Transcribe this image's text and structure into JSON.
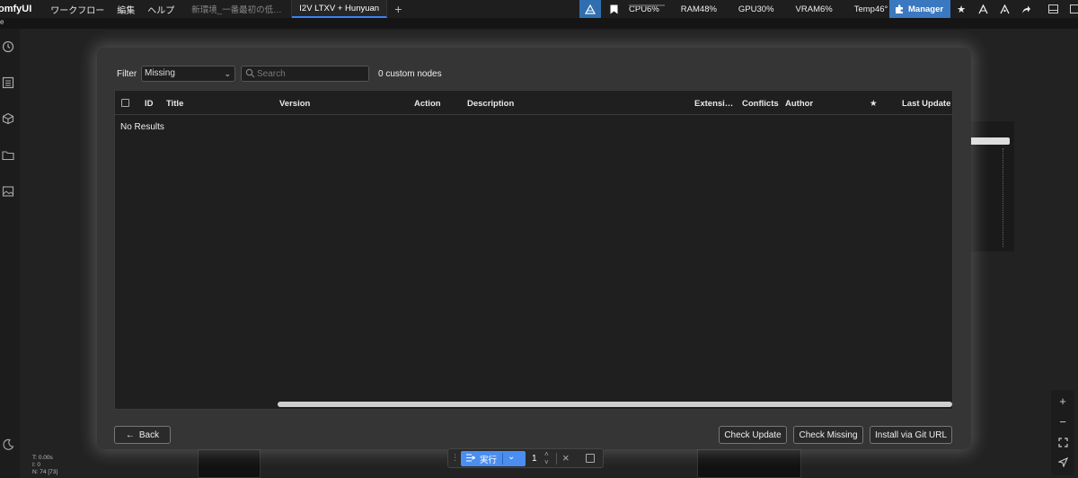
{
  "topbar": {
    "logo": "omfyUI",
    "menu": [
      "ワークフロー",
      "編集",
      "ヘルプ"
    ],
    "tabs": [
      {
        "label": "新環境_一番最初の低…",
        "active": false
      },
      {
        "label": "I2V LTXV + Hunyuan",
        "active": true
      }
    ],
    "add_tab": "+",
    "stats": [
      {
        "label": "CPU6%",
        "value": 6
      },
      {
        "label": "RAM48%",
        "value": 48
      },
      {
        "label": "GPU30%",
        "value": 30
      },
      {
        "label": "VRAM6%",
        "value": 6
      },
      {
        "label": "Temp46°",
        "value": 46
      }
    ],
    "manager_label": "Manager"
  },
  "subbar": {
    "text": "e"
  },
  "modal": {
    "filter_label": "Filter",
    "filter_value": "Missing",
    "search_placeholder": "Search",
    "count_text": "0 custom nodes",
    "columns": [
      "ID",
      "Title",
      "Version",
      "Action",
      "Description",
      "Extensi…",
      "Conflicts",
      "Author",
      "★",
      "Last Update"
    ],
    "empty_text": "No Results",
    "back_label": "Back",
    "check_update_label": "Check Update",
    "check_missing_label": "Check Missing",
    "install_git_label": "Install via Git URL"
  },
  "ministats": {
    "line1": "T: 0.00s",
    "line2": "I: 0",
    "line3": "N: 74 [73]"
  },
  "runbar": {
    "run_label": "実行",
    "count": "1"
  },
  "colors": {
    "accent": "#4a8ef0",
    "manager": "#3a78c0",
    "modal_bg": "#353535",
    "grid_bg": "#1f1f1f"
  }
}
